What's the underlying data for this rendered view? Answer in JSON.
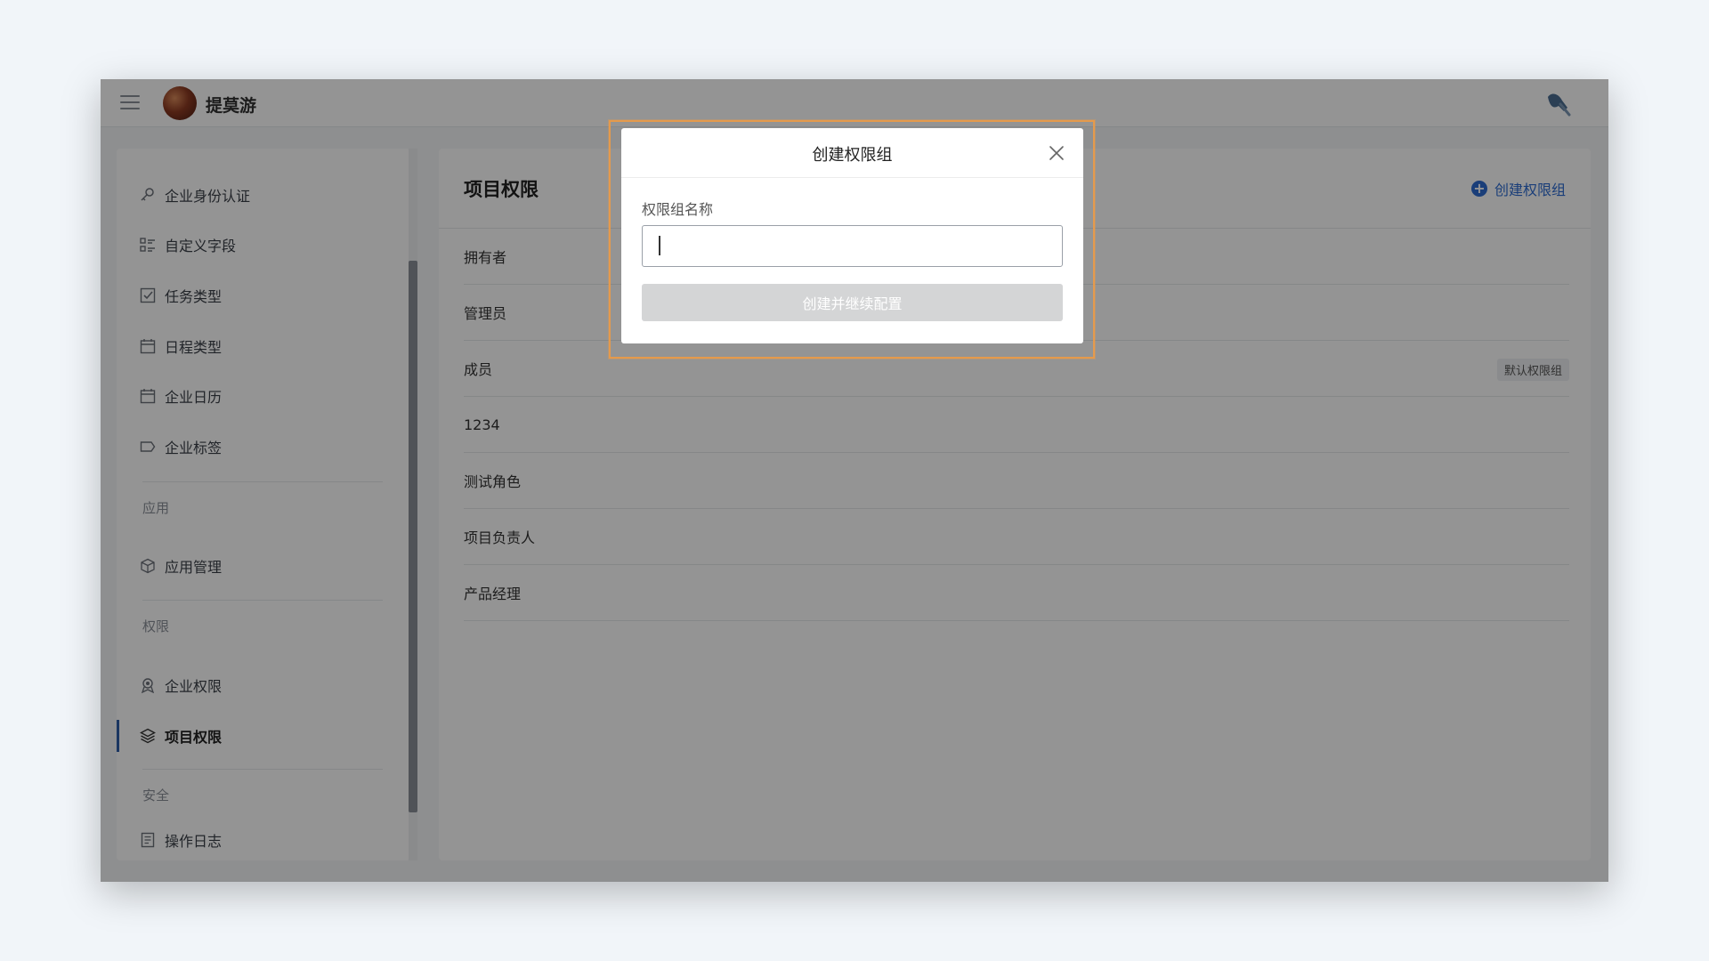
{
  "app": {
    "name": "提莫游"
  },
  "sidebar": {
    "items_top": [
      {
        "label": "企业身份认证",
        "icon": "key-icon"
      },
      {
        "label": "自定义字段",
        "icon": "list-icon"
      },
      {
        "label": "任务类型",
        "icon": "checkbox-icon"
      },
      {
        "label": "日程类型",
        "icon": "calendar-icon"
      },
      {
        "label": "企业日历",
        "icon": "calendar-icon"
      },
      {
        "label": "企业标签",
        "icon": "tag-icon"
      }
    ],
    "section_apps": "应用",
    "apps_items": [
      {
        "label": "应用管理",
        "icon": "cube-icon"
      }
    ],
    "section_perms": "权限",
    "perm_items": [
      {
        "label": "企业权限",
        "icon": "badge-icon"
      },
      {
        "label": "项目权限",
        "icon": "layers-icon",
        "active": true
      }
    ],
    "section_security": "安全",
    "security_items": [
      {
        "label": "操作日志",
        "icon": "document-icon"
      }
    ]
  },
  "main": {
    "title": "项目权限",
    "create_label": "创建权限组",
    "rows": [
      {
        "label": "拥有者"
      },
      {
        "label": "管理员"
      },
      {
        "label": "成员",
        "badge": "默认权限组"
      },
      {
        "label": "1234"
      },
      {
        "label": "测试角色"
      },
      {
        "label": "项目负责人"
      },
      {
        "label": "产品经理"
      }
    ]
  },
  "modal": {
    "title": "创建权限组",
    "field_label": "权限组名称",
    "input_value": "",
    "submit_label": "创建并继续配置"
  },
  "colors": {
    "accent": "#2e6cd1",
    "active_bar": "#2e5ea8",
    "focus_outline": "#e59a4c"
  }
}
